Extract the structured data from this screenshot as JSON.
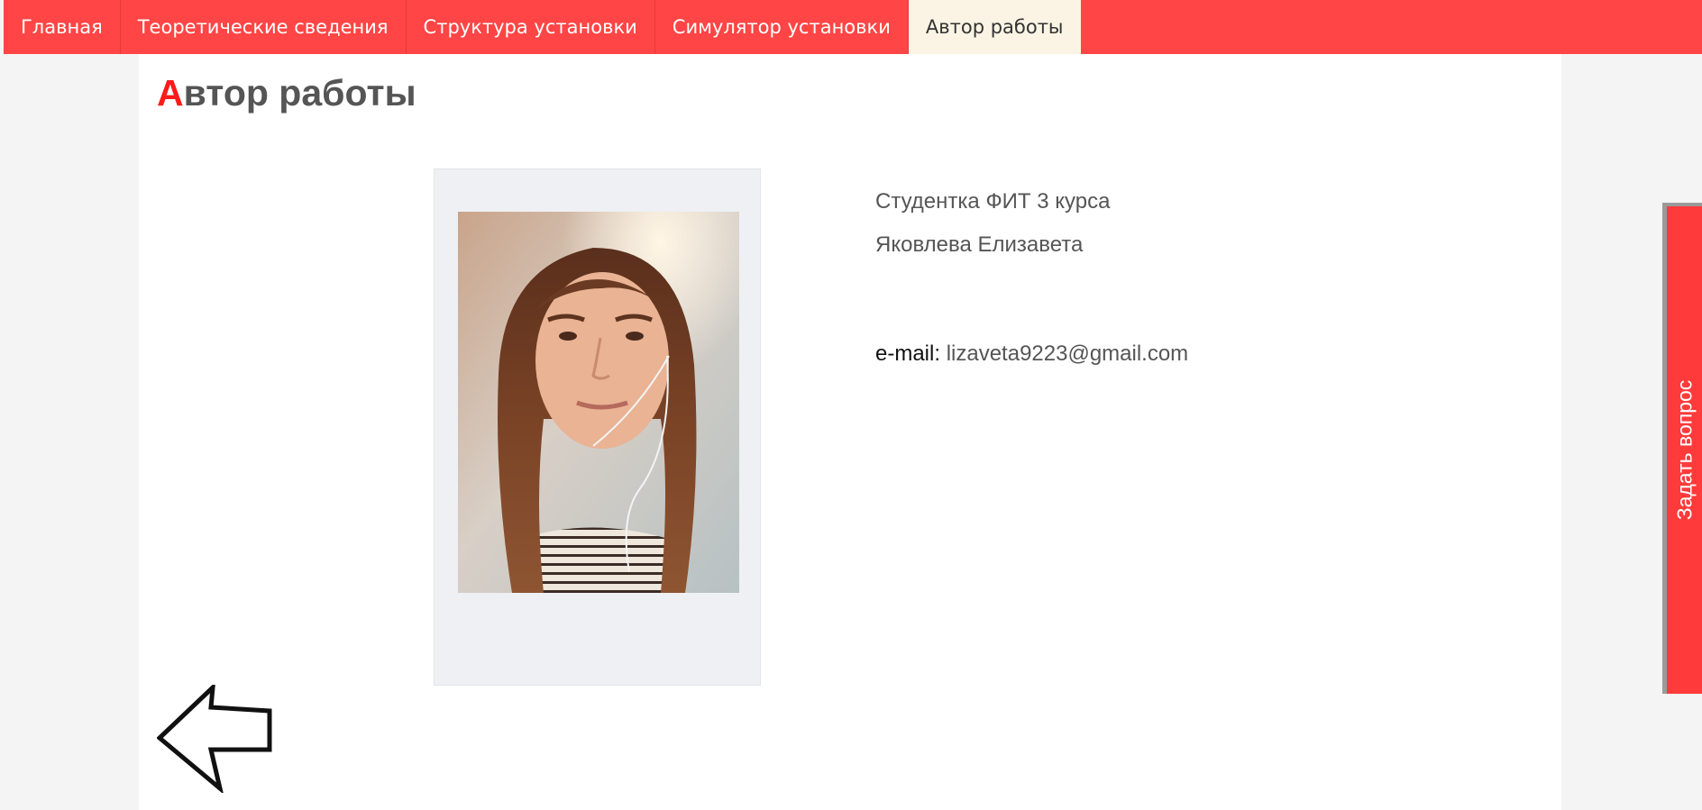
{
  "nav": {
    "items": [
      {
        "label": "Главная"
      },
      {
        "label": "Теоретические сведения"
      },
      {
        "label": "Структура установки"
      },
      {
        "label": "Симулятор установки"
      },
      {
        "label": "Автор работы"
      }
    ],
    "active_index": 4
  },
  "page": {
    "title_first_letter": "А",
    "title_rest": "втор работы"
  },
  "author": {
    "line1": "Студентка ФИТ 3 курса",
    "line2": "Яковлева Елизавета",
    "email_label": "e-mail:",
    "email": "lizaveta9223@gmail.com"
  },
  "side_tab": {
    "label": "Задать вопрос"
  },
  "colors": {
    "nav_background": "#ff4545",
    "nav_active_background": "#fbf4e4",
    "title_accent": "#ff1a1a",
    "side_tab": "#ff3a3a"
  },
  "icons": {
    "back": "arrow-left-outline-icon"
  }
}
